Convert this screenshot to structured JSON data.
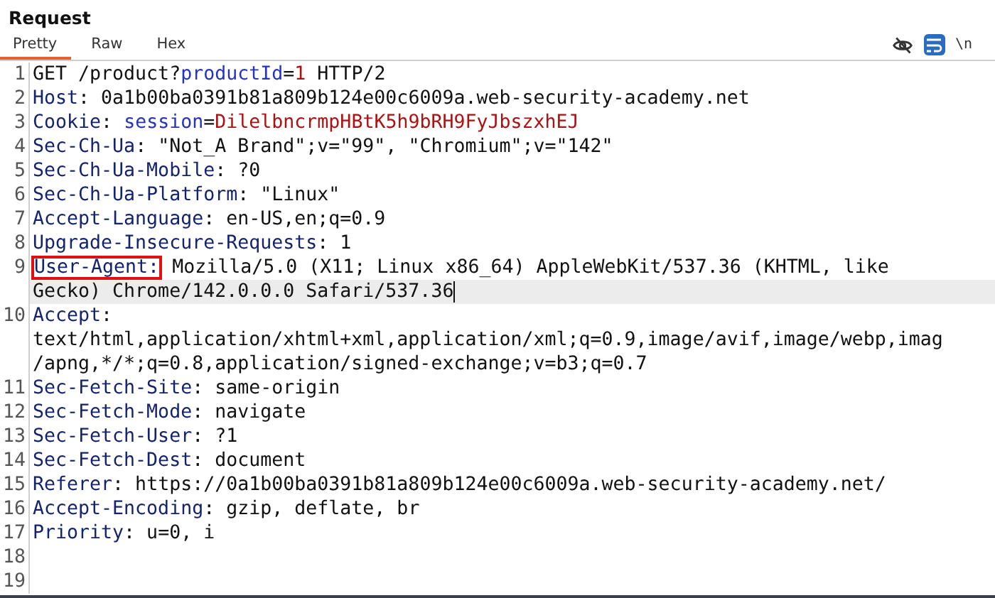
{
  "panel": {
    "title": "Request"
  },
  "tabs": [
    {
      "label": "Pretty",
      "selected": true
    },
    {
      "label": "Raw",
      "selected": false
    },
    {
      "label": "Hex",
      "selected": false
    }
  ],
  "toolbar": [
    {
      "kind": "eye-off",
      "on": false
    },
    {
      "kind": "wrap",
      "on": true
    },
    {
      "kind": "newline",
      "label": "\\n",
      "on": false
    }
  ],
  "lines": [
    {
      "number": "1",
      "rows": [
        {
          "current": false,
          "segments": [
            {
              "kind": "plain",
              "text": "GET /product?"
            },
            {
              "kind": "param",
              "text": "productId"
            },
            {
              "kind": "plain",
              "text": "="
            },
            {
              "kind": "value",
              "text": "1"
            },
            {
              "kind": "plain",
              "text": " HTTP/2"
            }
          ]
        }
      ]
    },
    {
      "number": "2",
      "rows": [
        {
          "current": false,
          "segments": [
            {
              "kind": "name",
              "text": "Host"
            },
            {
              "kind": "plain",
              "text": ": 0a1b00ba0391b81a809b124e00c6009a.web-security-academy.net"
            }
          ]
        }
      ]
    },
    {
      "number": "3",
      "rows": [
        {
          "current": false,
          "segments": [
            {
              "kind": "name",
              "text": "Cookie"
            },
            {
              "kind": "plain",
              "text": ": "
            },
            {
              "kind": "param",
              "text": "session"
            },
            {
              "kind": "plain",
              "text": "="
            },
            {
              "kind": "value",
              "text": "DilelbncrmpHBtK5h9bRH9FyJbszxhEJ"
            }
          ]
        }
      ]
    },
    {
      "number": "4",
      "rows": [
        {
          "current": false,
          "segments": [
            {
              "kind": "name",
              "text": "Sec-Ch-Ua"
            },
            {
              "kind": "plain",
              "text": ": \"Not_A Brand\";v=\"99\", \"Chromium\";v=\"142\""
            }
          ]
        }
      ]
    },
    {
      "number": "5",
      "rows": [
        {
          "current": false,
          "segments": [
            {
              "kind": "name",
              "text": "Sec-Ch-Ua-Mobile"
            },
            {
              "kind": "plain",
              "text": ": ?0"
            }
          ]
        }
      ]
    },
    {
      "number": "6",
      "rows": [
        {
          "current": false,
          "segments": [
            {
              "kind": "name",
              "text": "Sec-Ch-Ua-Platform"
            },
            {
              "kind": "plain",
              "text": ": \"Linux\""
            }
          ]
        }
      ]
    },
    {
      "number": "7",
      "rows": [
        {
          "current": false,
          "segments": [
            {
              "kind": "name",
              "text": "Accept-Language"
            },
            {
              "kind": "plain",
              "text": ": en-US,en;q=0.9"
            }
          ]
        }
      ]
    },
    {
      "number": "8",
      "rows": [
        {
          "current": false,
          "segments": [
            {
              "kind": "name",
              "text": "Upgrade-Insecure-Requests"
            },
            {
              "kind": "plain",
              "text": ": 1"
            }
          ]
        }
      ]
    },
    {
      "number": "9",
      "rows": [
        {
          "current": false,
          "segments": [
            {
              "kind": "name",
              "text": "User-Agent:",
              "boxed": true
            },
            {
              "kind": "plain",
              "text": " Mozilla/5.0 (X11; Linux x86_64) AppleWebKit/537.36 (KHTML, like"
            }
          ]
        },
        {
          "current": true,
          "segments": [
            {
              "kind": "plain",
              "text": "Gecko) Chrome/142.0.0.0 Safari/537.36"
            }
          ]
        }
      ]
    },
    {
      "number": "10",
      "rows": [
        {
          "current": false,
          "segments": [
            {
              "kind": "name",
              "text": "Accept"
            },
            {
              "kind": "plain",
              "text": ":"
            }
          ]
        },
        {
          "current": false,
          "segments": [
            {
              "kind": "plain",
              "text": "text/html,application/xhtml+xml,application/xml;q=0.9,image/avif,image/webp,imag"
            }
          ]
        },
        {
          "current": false,
          "segments": [
            {
              "kind": "plain",
              "text": "/apng,*/*;q=0.8,application/signed-exchange;v=b3;q=0.7"
            }
          ]
        }
      ]
    },
    {
      "number": "11",
      "rows": [
        {
          "current": false,
          "segments": [
            {
              "kind": "name",
              "text": "Sec-Fetch-Site"
            },
            {
              "kind": "plain",
              "text": ": same-origin"
            }
          ]
        }
      ]
    },
    {
      "number": "12",
      "rows": [
        {
          "current": false,
          "segments": [
            {
              "kind": "name",
              "text": "Sec-Fetch-Mode"
            },
            {
              "kind": "plain",
              "text": ": navigate"
            }
          ]
        }
      ]
    },
    {
      "number": "13",
      "rows": [
        {
          "current": false,
          "segments": [
            {
              "kind": "name",
              "text": "Sec-Fetch-User"
            },
            {
              "kind": "plain",
              "text": ": ?1"
            }
          ]
        }
      ]
    },
    {
      "number": "14",
      "rows": [
        {
          "current": false,
          "segments": [
            {
              "kind": "name",
              "text": "Sec-Fetch-Dest"
            },
            {
              "kind": "plain",
              "text": ": document"
            }
          ]
        }
      ]
    },
    {
      "number": "15",
      "rows": [
        {
          "current": false,
          "segments": [
            {
              "kind": "name",
              "text": "Referer"
            },
            {
              "kind": "plain",
              "text": ": https://0a1b00ba0391b81a809b124e00c6009a.web-security-academy.net/"
            }
          ]
        }
      ]
    },
    {
      "number": "16",
      "rows": [
        {
          "current": false,
          "segments": [
            {
              "kind": "name",
              "text": "Accept-Encoding"
            },
            {
              "kind": "plain",
              "text": ": gzip, deflate, br"
            }
          ]
        }
      ]
    },
    {
      "number": "17",
      "rows": [
        {
          "current": false,
          "segments": [
            {
              "kind": "name",
              "text": "Priority"
            },
            {
              "kind": "plain",
              "text": ": u=0, i"
            }
          ]
        }
      ]
    },
    {
      "number": "18"
    },
    {
      "number": "19"
    }
  ]
}
